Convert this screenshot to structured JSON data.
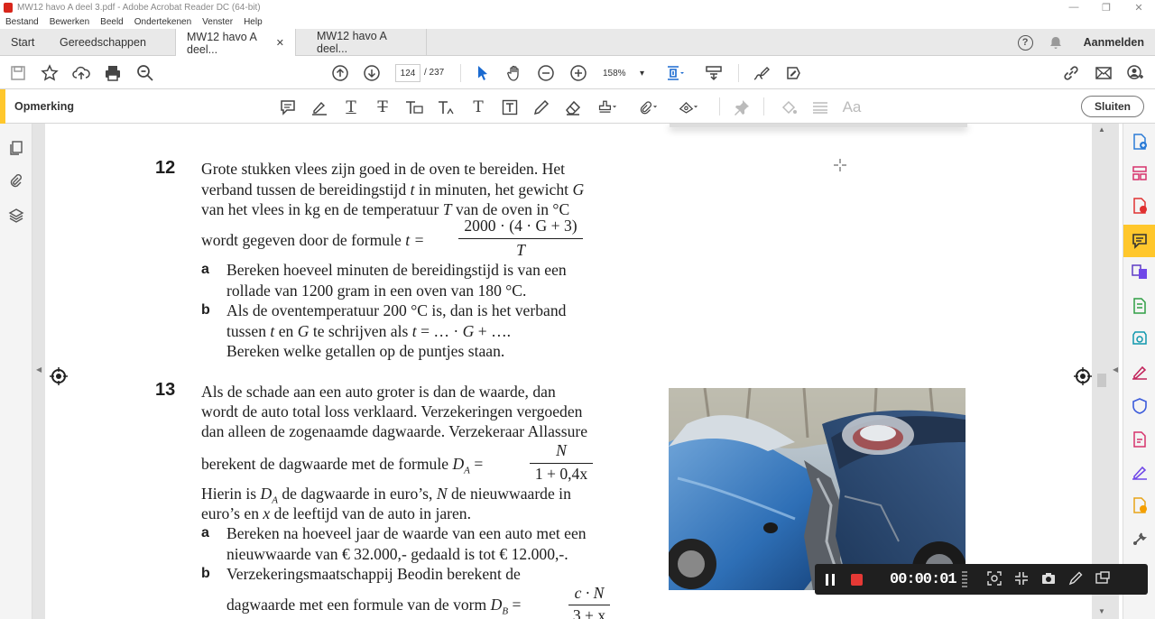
{
  "window": {
    "title": "MW12 havo A deel 3.pdf - Adobe Acrobat Reader DC (64-bit)",
    "minimize": "—",
    "maximize": "❐",
    "close": "✕"
  },
  "menu": [
    "Bestand",
    "Bewerken",
    "Beeld",
    "Ondertekenen",
    "Venster",
    "Help"
  ],
  "tabs": {
    "home": "Start",
    "tools": "Gereedschappen",
    "doc1": "MW12 havo A deel...",
    "doc2": "MW12 havo A deel...",
    "close_glyph": "✕",
    "help_glyph": "?",
    "signin": "Aanmelden"
  },
  "toolbar": {
    "page_current": "124",
    "page_total": "/  237",
    "zoom": "158%",
    "zoom_caret": "▾"
  },
  "comment_toolbar": {
    "label": "Opmerking",
    "close_label": "Sluiten",
    "text_glyph": "T",
    "font_glyph": "Aa"
  },
  "document": {
    "q12": {
      "number": "12",
      "lines": [
        "Grote stukken vlees zijn goed in de oven te bereiden. Het",
        "verband tussen de bereidingstijd",
        "in minuten, het gewicht",
        "van het vlees in kg en de temperatuur",
        "van de oven in °C",
        "wordt gegeven door de formule"
      ],
      "var_t": "t",
      "var_G": "G",
      "var_T": "T",
      "formula_lhs": "t =",
      "formula_num": "2000 · (4 · G + 3)",
      "formula_den": "T",
      "a_label": "a",
      "a_lines": [
        "Bereken hoeveel minuten de bereidingstijd is van een",
        "rollade van 1200 gram in een oven van 180 °C."
      ],
      "b_label": "b",
      "b_lines": [
        "Als de oventemperatuur 200 °C is, dan is het verband",
        "tussen",
        "en",
        "te schrijven als",
        "= … ·",
        "+ ….",
        "Bereken welke getallen op de puntjes staan."
      ]
    },
    "q13": {
      "number": "13",
      "lines": [
        "Als de schade aan een auto groter is dan de waarde, dan",
        "wordt de auto total loss verklaard. Verzekeringen vergoeden",
        "dan alleen de zogenaamde dagwaarde. Verzekeraar Allassure",
        "berekent de dagwaarde met de formule"
      ],
      "formula_lhs_D": "D",
      "formula_lhs_sub": "A",
      "formula_eq": "=",
      "formula_num": "N",
      "formula_den": "1 + 0,4x",
      "hierin_lines": [
        "Hierin is",
        "de dagwaarde in euro’s,",
        "de nieuwwaarde in",
        "euro’s en",
        "de leeftijd van de auto in jaren."
      ],
      "var_N": "N",
      "var_x": "x",
      "a_label": "a",
      "a_lines": [
        "Bereken na hoeveel jaar de waarde van een auto met een",
        "nieuwwaarde van € 32.000,- gedaald is tot € 12.000,-."
      ],
      "b_label": "b",
      "b_lines": [
        "Verzekeringsmaatschappij Beodin berekent de",
        "dagwaarde met een formule van de vorm"
      ],
      "b_formula_sub": "B",
      "b_formula_num": "c · N",
      "b_formula_den": "3 + x"
    }
  },
  "recorder": {
    "time": "00:00:01"
  },
  "colors": {
    "accent_yellow": "#ffc72c",
    "record_red": "#e53935",
    "acrobat_red": "#d8261b"
  }
}
